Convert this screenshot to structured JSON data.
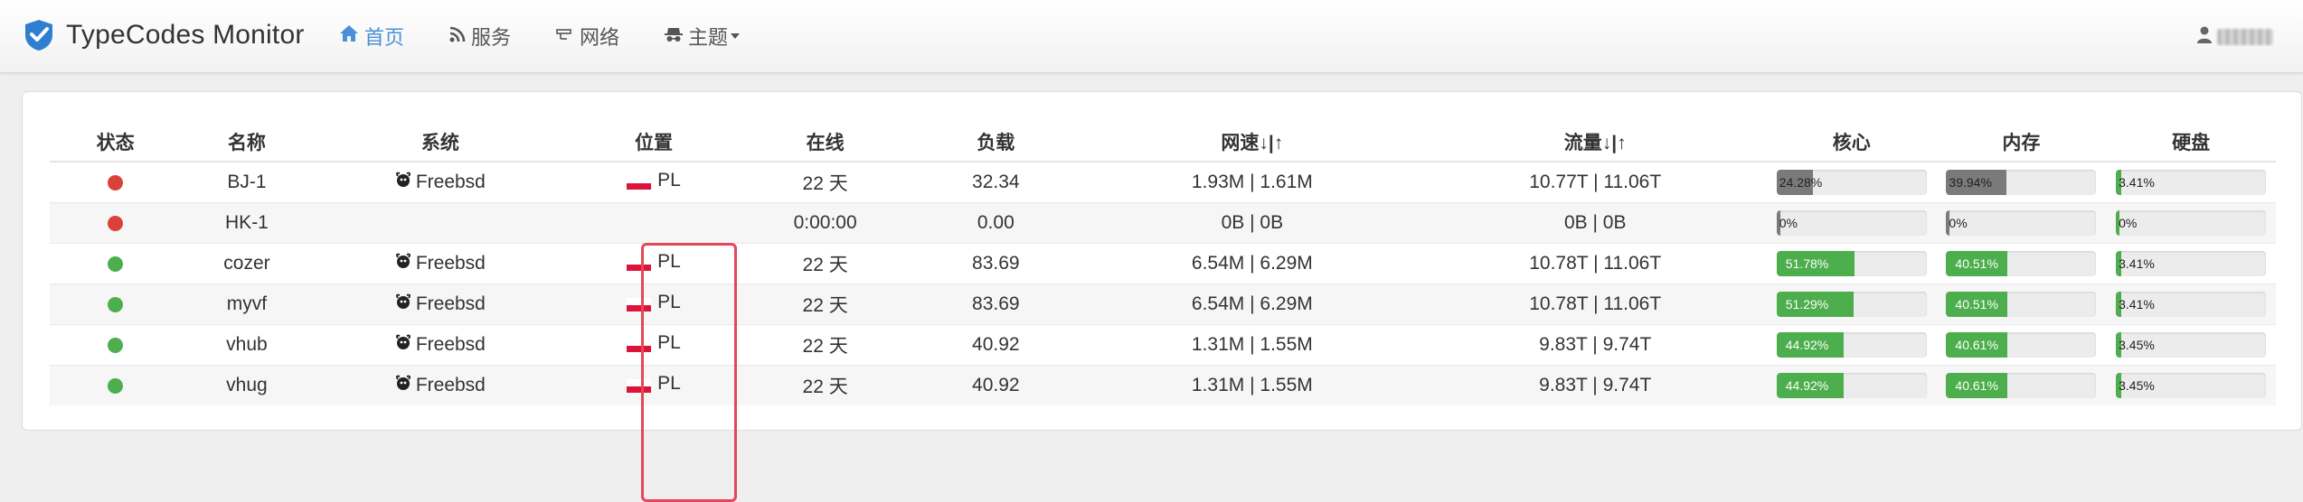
{
  "app": {
    "title": "TypeCodes Monitor"
  },
  "nav": [
    {
      "label": "首页",
      "icon": "home-icon",
      "active": true
    },
    {
      "label": "服务",
      "icon": "rss-icon"
    },
    {
      "label": "网络",
      "icon": "network-icon"
    },
    {
      "label": "主题",
      "icon": "incognito-icon",
      "dropdown": true
    }
  ],
  "table": {
    "headers": {
      "status": "状态",
      "name": "名称",
      "os": "系统",
      "location": "位置",
      "uptime": "在线",
      "load": "负载",
      "speed": "网速↓|↑",
      "traffic": "流量↓|↑",
      "cpu": "核心",
      "mem": "内存",
      "disk": "硬盘"
    },
    "rows": [
      {
        "status_color": "#d9413a",
        "name": "BJ-1",
        "os": "Freebsd",
        "location": "PL",
        "uptime": "22 天",
        "load": "32.34",
        "speed": "1.93M | 1.61M",
        "traffic": "10.77T | 11.06T",
        "cpu": "24.28%",
        "cpu_value": 24.28,
        "mem": "39.94%",
        "mem_value": 39.94,
        "disk": "3.41%",
        "disk_value": 3.41,
        "bar_color": "#7a7a7a"
      },
      {
        "status_color": "#d9413a",
        "name": "HK-1",
        "os": "",
        "location": "",
        "uptime": "0:00:00",
        "load": "0.00",
        "speed": "0B | 0B",
        "traffic": "0B | 0B",
        "cpu": "0%",
        "cpu_value": 0,
        "mem": "0%",
        "mem_value": 0,
        "disk": "0%",
        "disk_value": 0,
        "bar_color": "#7a7a7a"
      },
      {
        "status_color": "#4cae4c",
        "name": "cozer",
        "os": "Freebsd",
        "location": "PL",
        "uptime": "22 天",
        "load": "83.69",
        "speed": "6.54M | 6.29M",
        "traffic": "10.78T | 11.06T",
        "cpu": "51.78%",
        "cpu_value": 51.78,
        "mem": "40.51%",
        "mem_value": 40.51,
        "disk": "3.41%",
        "disk_value": 3.41,
        "bar_color": "#4cae4c"
      },
      {
        "status_color": "#4cae4c",
        "name": "myvf",
        "os": "Freebsd",
        "location": "PL",
        "uptime": "22 天",
        "load": "83.69",
        "speed": "6.54M | 6.29M",
        "traffic": "10.78T | 11.06T",
        "cpu": "51.29%",
        "cpu_value": 51.29,
        "mem": "40.51%",
        "mem_value": 40.51,
        "disk": "3.41%",
        "disk_value": 3.41,
        "bar_color": "#4cae4c"
      },
      {
        "status_color": "#4cae4c",
        "name": "vhub",
        "os": "Freebsd",
        "location": "PL",
        "uptime": "22 天",
        "load": "40.92",
        "speed": "1.31M | 1.55M",
        "traffic": "9.83T | 9.74T",
        "cpu": "44.92%",
        "cpu_value": 44.92,
        "mem": "40.61%",
        "mem_value": 40.61,
        "disk": "3.45%",
        "disk_value": 3.45,
        "bar_color": "#4cae4c"
      },
      {
        "status_color": "#4cae4c",
        "name": "vhug",
        "os": "Freebsd",
        "location": "PL",
        "uptime": "22 天",
        "load": "40.92",
        "speed": "1.31M | 1.55M",
        "traffic": "9.83T | 9.74T",
        "cpu": "44.92%",
        "cpu_value": 44.92,
        "mem": "40.61%",
        "mem_value": 40.61,
        "disk": "3.45%",
        "disk_value": 3.45,
        "bar_color": "#4cae4c"
      }
    ]
  },
  "colors": {
    "accent": "#4a90d9",
    "online": "#4cae4c",
    "offline": "#d9413a",
    "highlight": "#e8455a"
  }
}
